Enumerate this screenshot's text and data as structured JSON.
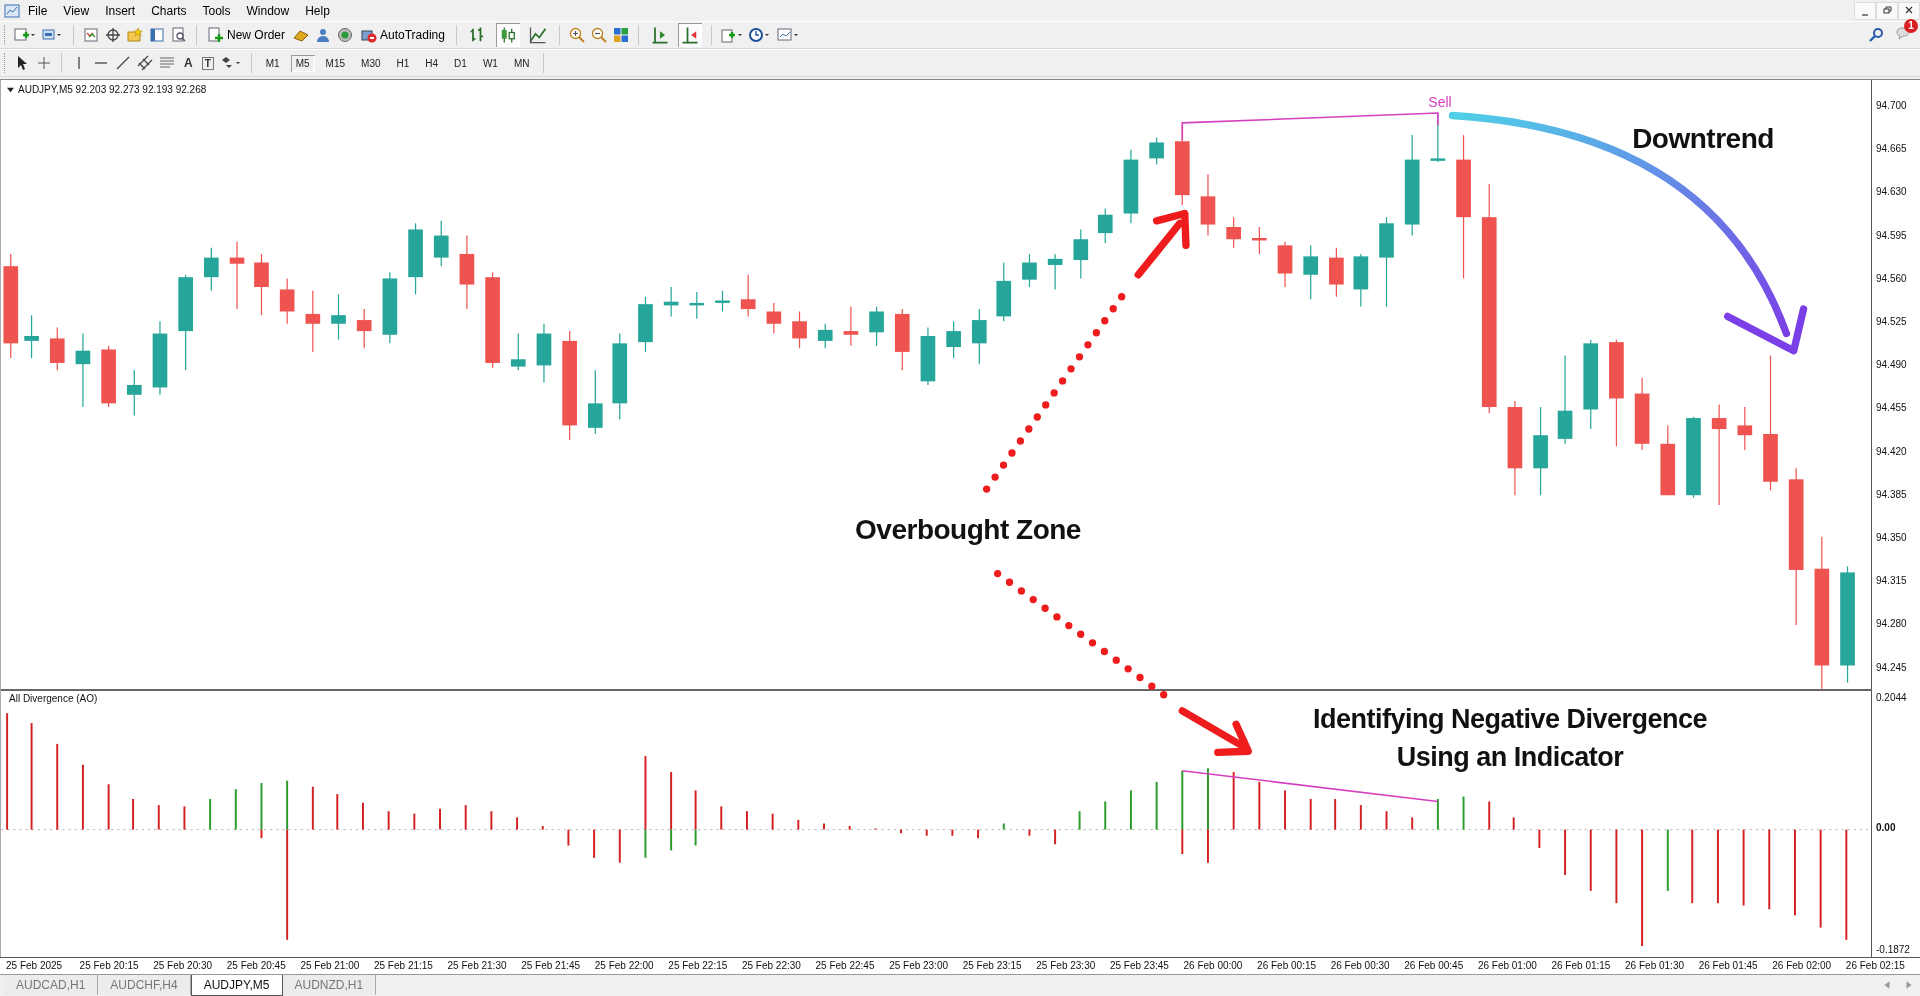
{
  "menu": [
    "File",
    "View",
    "Insert",
    "Charts",
    "Tools",
    "Window",
    "Help"
  ],
  "toolbar": {
    "new_order": "New Order",
    "autotrading": "AutoTrading",
    "chart_type_buttons": [
      {
        "kind": "bars",
        "selected": false
      },
      {
        "kind": "candles",
        "selected": true
      },
      {
        "kind": "line",
        "selected": false
      }
    ],
    "shift_buttons": [
      {
        "kind": "shift",
        "selected": false
      },
      {
        "kind": "autoscroll",
        "selected": true
      }
    ]
  },
  "notifications": {
    "count": "1"
  },
  "drawing_tools": {
    "text_tool": "A",
    "label_tool": "T"
  },
  "timeframes": [
    {
      "label": "M1",
      "selected": false
    },
    {
      "label": "M5",
      "selected": true
    },
    {
      "label": "M15",
      "selected": false
    },
    {
      "label": "M30",
      "selected": false
    },
    {
      "label": "H1",
      "selected": false
    },
    {
      "label": "H4",
      "selected": false
    },
    {
      "label": "D1",
      "selected": false
    },
    {
      "label": "W1",
      "selected": false
    },
    {
      "label": "MN",
      "selected": false
    }
  ],
  "chart": {
    "header": "AUDJPY,M5  92.203 92.273 92.193 92.268",
    "price_ticks": [
      "94.700",
      "94.665",
      "94.630",
      "94.595",
      "94.560",
      "94.525",
      "94.490",
      "94.455",
      "94.420",
      "94.385",
      "94.350",
      "94.315",
      "94.280",
      "94.245"
    ],
    "sell_label": "Sell",
    "indicator": {
      "title": "All Divergence (AO)",
      "ticks": [
        "0.2044",
        "0.00",
        "-0.1872"
      ]
    },
    "time_labels": [
      "25 Feb 2025",
      "25 Feb 20:15",
      "25 Feb 20:30",
      "25 Feb 20:45",
      "25 Feb 21:00",
      "25 Feb 21:15",
      "25 Feb 21:30",
      "25 Feb 21:45",
      "25 Feb 22:00",
      "25 Feb 22:15",
      "25 Feb 22:30",
      "25 Feb 22:45",
      "25 Feb 23:00",
      "25 Feb 23:15",
      "25 Feb 23:30",
      "25 Feb 23:45",
      "26 Feb 00:00",
      "26 Feb 00:15",
      "26 Feb 00:30",
      "26 Feb 00:45",
      "26 Feb 01:00",
      "26 Feb 01:15",
      "26 Feb 01:30",
      "26 Feb 01:45",
      "26 Feb 02:00",
      "26 Feb 02:15"
    ]
  },
  "annotations": {
    "downtrend": "Downtrend",
    "overbought": "Overbought Zone",
    "divergence": [
      "Identifying Negative Divergence",
      "Using an Indicator"
    ]
  },
  "tabs": [
    {
      "label": "AUDCAD,H1",
      "selected": false
    },
    {
      "label": "AUDCHF,H4",
      "selected": false
    },
    {
      "label": "AUDJPY,M5",
      "selected": true
    },
    {
      "label": "AUDNZD,H1",
      "selected": false
    }
  ]
}
